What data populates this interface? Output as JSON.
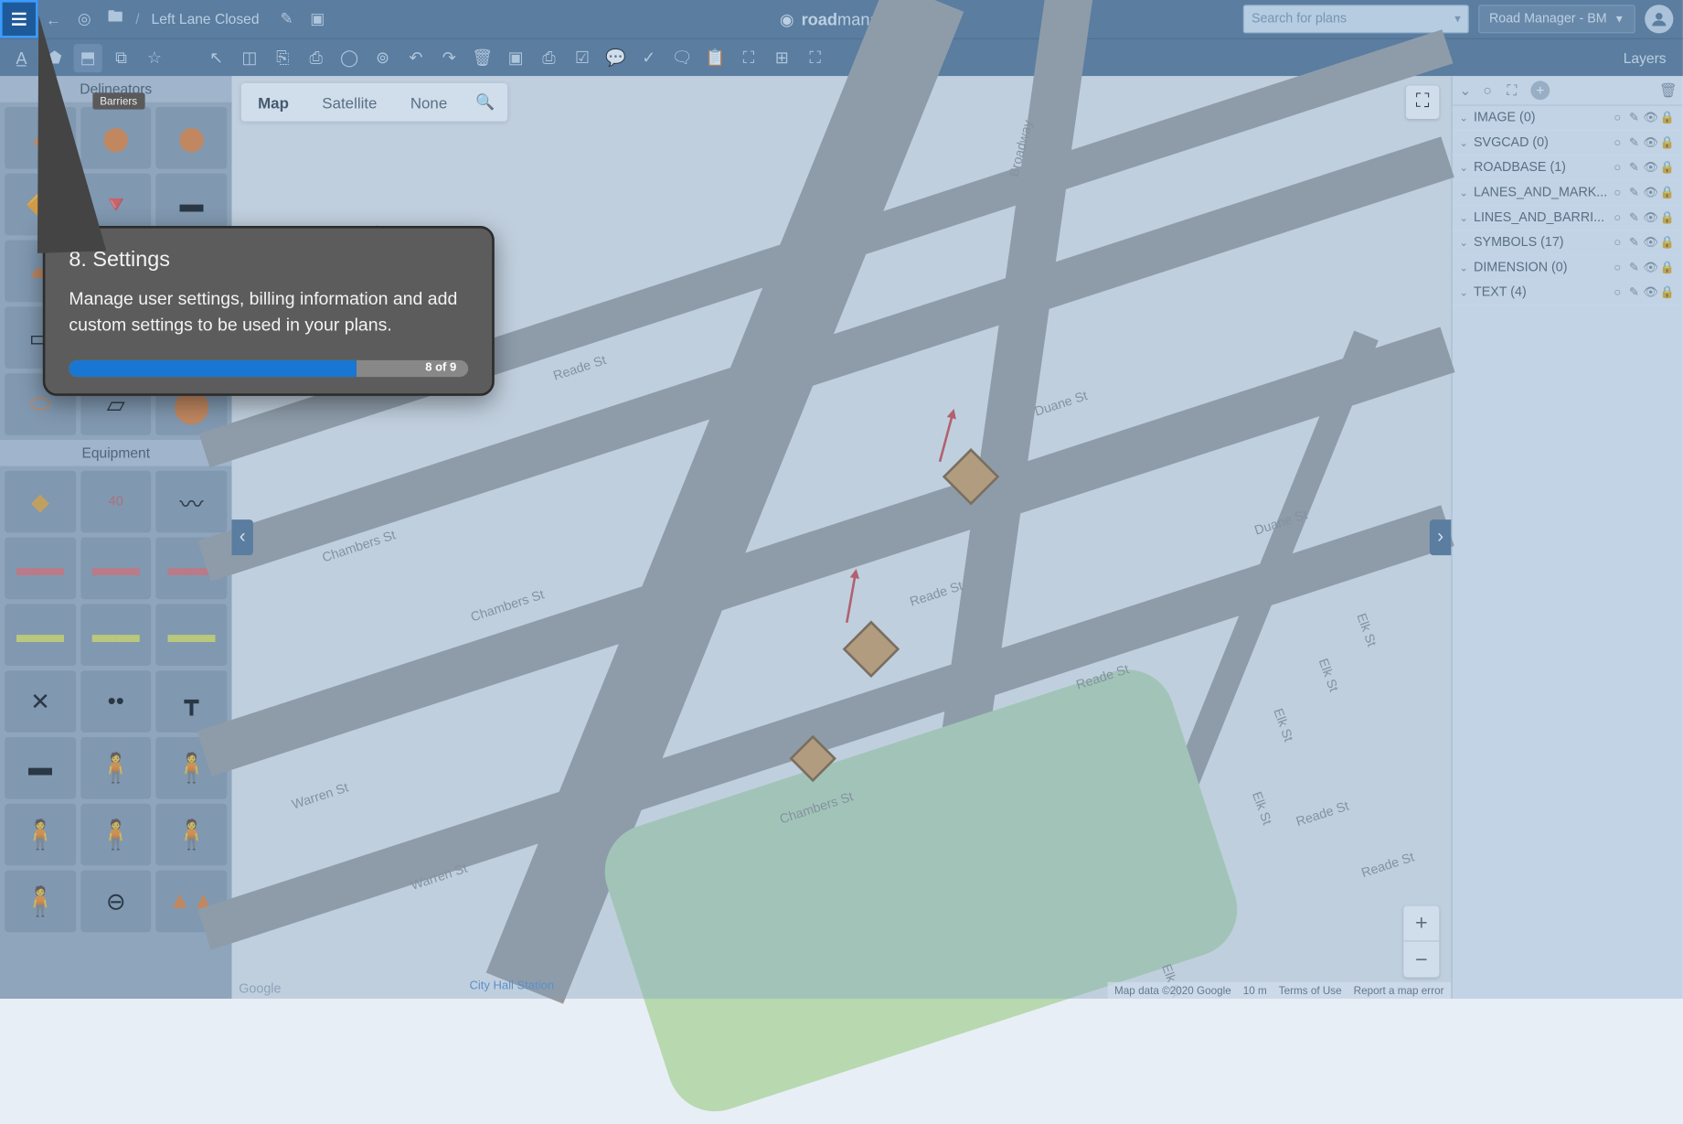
{
  "header": {
    "plan_title": "Left Lane Closed",
    "brand_prefix": "road",
    "brand_suffix": "manager",
    "search_placeholder": "Search for plans",
    "user_label": "Road Manager - BM"
  },
  "toolbar": {
    "layers_label": "Layers"
  },
  "palette": {
    "delineators_label": "Delineators",
    "barriers_tooltip": "Barriers",
    "equipment_label": "Equipment"
  },
  "map": {
    "tabs": {
      "map": "Map",
      "satellite": "Satellite",
      "none": "None"
    },
    "streets": {
      "broadway": "Broadway",
      "reade": "Reade St",
      "chambers": "Chambers St",
      "duane": "Duane St",
      "elk": "Elk St",
      "warren": "Warren St"
    },
    "station": "City Hall Station",
    "footer": {
      "data": "Map data ©2020 Google",
      "scale": "10 m",
      "terms": "Terms of Use",
      "report": "Report a map error"
    },
    "google": "Google"
  },
  "layers_panel": {
    "items": [
      {
        "name": "IMAGE (0)"
      },
      {
        "name": "SVGCAD (0)"
      },
      {
        "name": "ROADBASE (1)"
      },
      {
        "name": "LANES_AND_MARK..."
      },
      {
        "name": "LINES_AND_BARRI..."
      },
      {
        "name": "SYMBOLS (17)"
      },
      {
        "name": "DIMENSION (0)"
      },
      {
        "name": "TEXT (4)"
      }
    ]
  },
  "tutorial": {
    "title": "8. Settings",
    "body": "Manage user settings, billing information and add custom settings to be used in your plans.",
    "progress_label": "8 of 9"
  }
}
